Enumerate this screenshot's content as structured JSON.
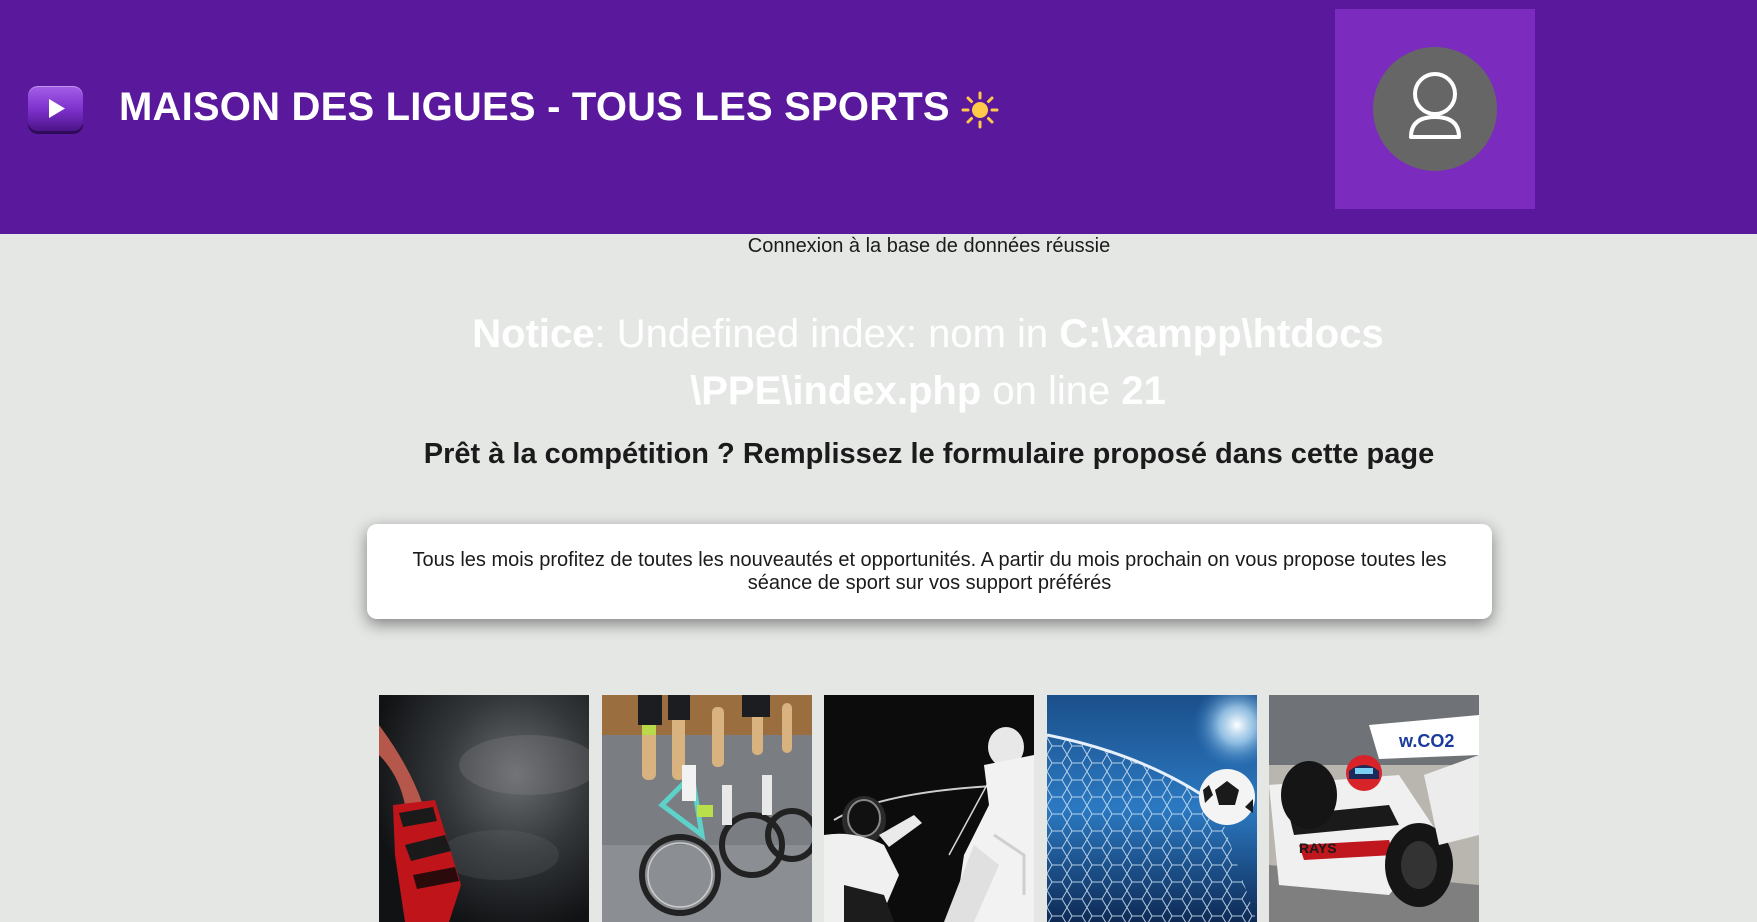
{
  "header": {
    "title": "MAISON DES LIGUES - TOUS LES SPORTS",
    "logo_icon": "play-icon",
    "theme_icon": "sun-icon",
    "profile_icon": "user-icon",
    "colors": {
      "header_bg": "#5a189d",
      "profile_bg": "#7b2cbf",
      "sun": "#ffc94a"
    }
  },
  "main": {
    "db_status": "Connexion à la base de données réussie",
    "notice": {
      "label": "Notice",
      "text1": ": Undefined index: nom in ",
      "path1": "C:\\xampp\\htdocs",
      "path2": "\\PPE\\index.php",
      "text2": " on line ",
      "line": "21"
    },
    "tagline": "Prêt à la compétition ? Remplissez le formulaire proposé dans cette page",
    "info": "Tous les mois profitez de toutes les nouveautés et opportunités. A partir du mois prochain on vous propose toutes les séance de sport sur vos support préférés"
  },
  "gallery": {
    "tiles": [
      {
        "subject": "boxing",
        "icon": "boxing-glove-image"
      },
      {
        "subject": "cycling",
        "icon": "cycling-image"
      },
      {
        "subject": "fencing",
        "icon": "fencing-image"
      },
      {
        "subject": "football",
        "icon": "football-net-image"
      },
      {
        "subject": "formula-1",
        "icon": "racing-car-image",
        "car_text": "RAYS",
        "banner_text": "w.CO2"
      }
    ]
  }
}
